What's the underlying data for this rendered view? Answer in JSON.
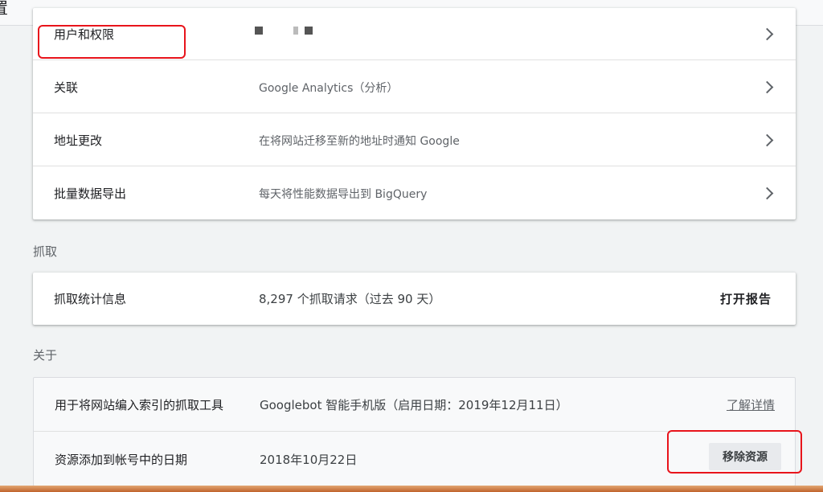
{
  "topbar": {
    "title_fragment": "置"
  },
  "settings": {
    "rows": [
      {
        "label": "用户和权限",
        "desc": ""
      },
      {
        "label": "关联",
        "desc": "Google Analytics（分析）"
      },
      {
        "label": "地址更改",
        "desc": "在将网站迁移至新的地址时通知 Google"
      },
      {
        "label": "批量数据导出",
        "desc": "每天将性能数据导出到 BigQuery"
      }
    ]
  },
  "crawl": {
    "section_title": "抓取",
    "label": "抓取统计信息",
    "desc": "8,297 个抓取请求（过去 90 天）",
    "action": "打开报告"
  },
  "about": {
    "section_title": "关于",
    "rows": [
      {
        "label": "用于将网站编入索引的抓取工具",
        "desc": "Googlebot 智能手机版（启用日期：2019年12月11日）",
        "action": "了解详情"
      },
      {
        "label": "资源添加到帐号中的日期",
        "desc": "2018年10月22日",
        "action": "移除资源"
      }
    ]
  },
  "colors": {
    "annotation": "#e8141b",
    "card_bg": "#ffffff",
    "page_bg": "#f1f3f4"
  },
  "icons": {
    "row_chevron": "chevron-right-icon"
  }
}
